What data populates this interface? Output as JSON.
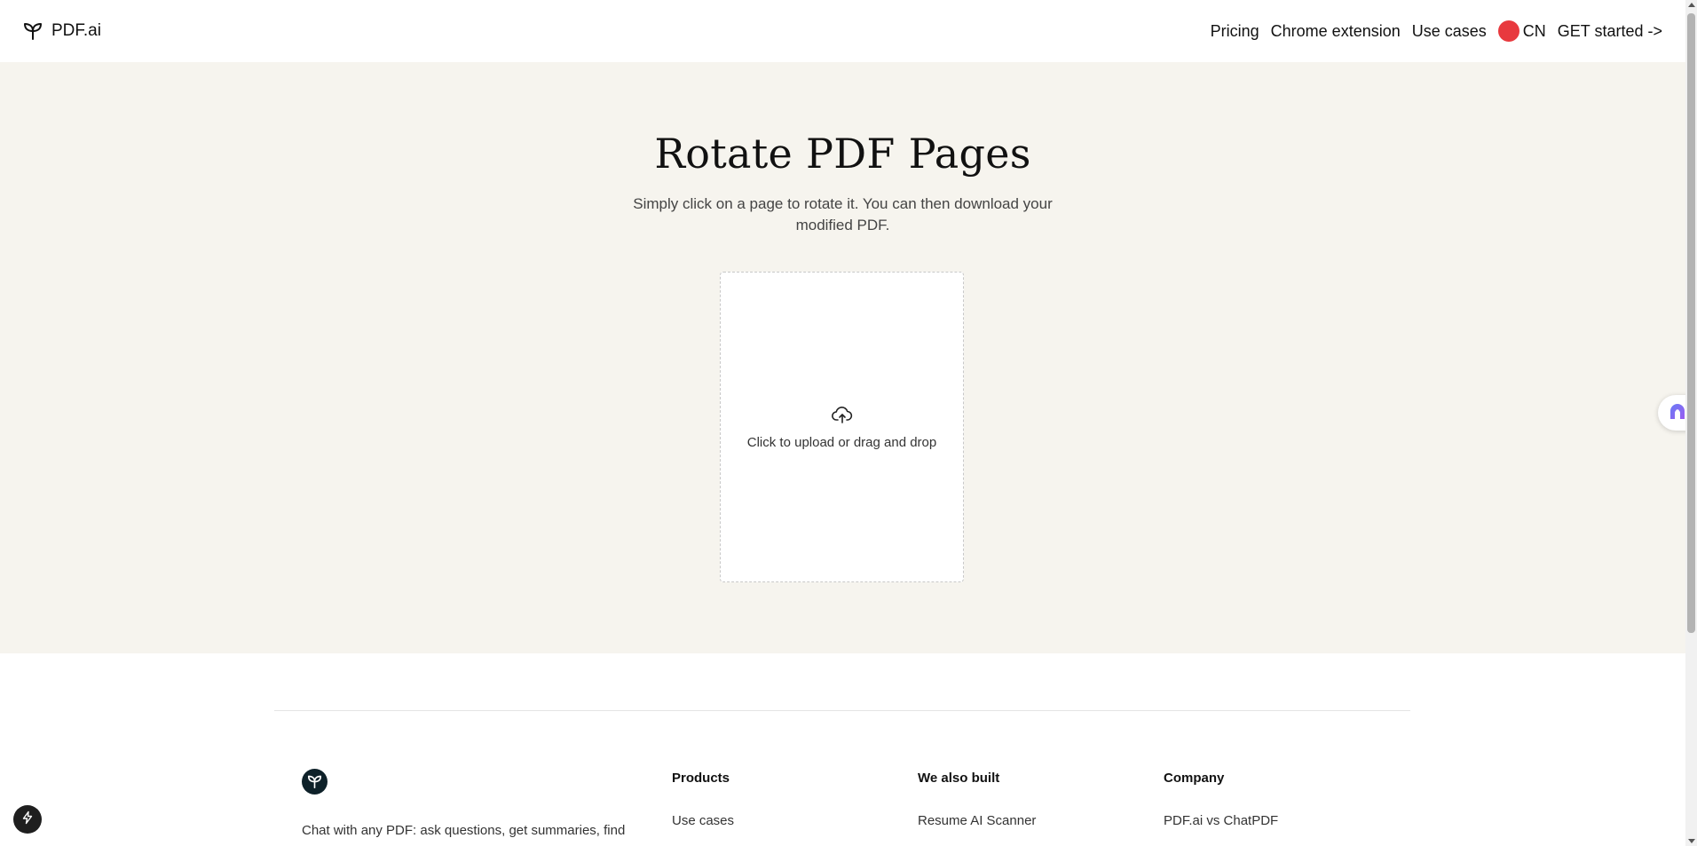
{
  "header": {
    "brand": "PDF.ai",
    "nav": {
      "pricing": "Pricing",
      "chrome_extension": "Chrome extension",
      "use_cases": "Use cases",
      "language": "CN",
      "get_started": "GET started ->"
    }
  },
  "hero": {
    "title": "Rotate PDF Pages",
    "subtitle": "Simply click on a page to rotate it. You can then download your modified PDF.",
    "upload_text": "Click to upload or drag and drop"
  },
  "footer": {
    "description": "Chat with any PDF: ask questions, get summaries, find",
    "columns": [
      {
        "heading": "Products",
        "links": [
          "Use cases"
        ]
      },
      {
        "heading": "We also built",
        "links": [
          "Resume AI Scanner"
        ]
      },
      {
        "heading": "Company",
        "links": [
          "PDF.ai vs ChatPDF"
        ]
      }
    ]
  },
  "colors": {
    "hero_background": "#f6f4ee",
    "language_dot": "#e8393e",
    "footer_logo": "#0e2129"
  },
  "icons": {
    "brand": "sprout-icon",
    "upload": "cloud-upload-icon",
    "assistant": "assistant-icon",
    "quick_action": "lightning-icon"
  }
}
